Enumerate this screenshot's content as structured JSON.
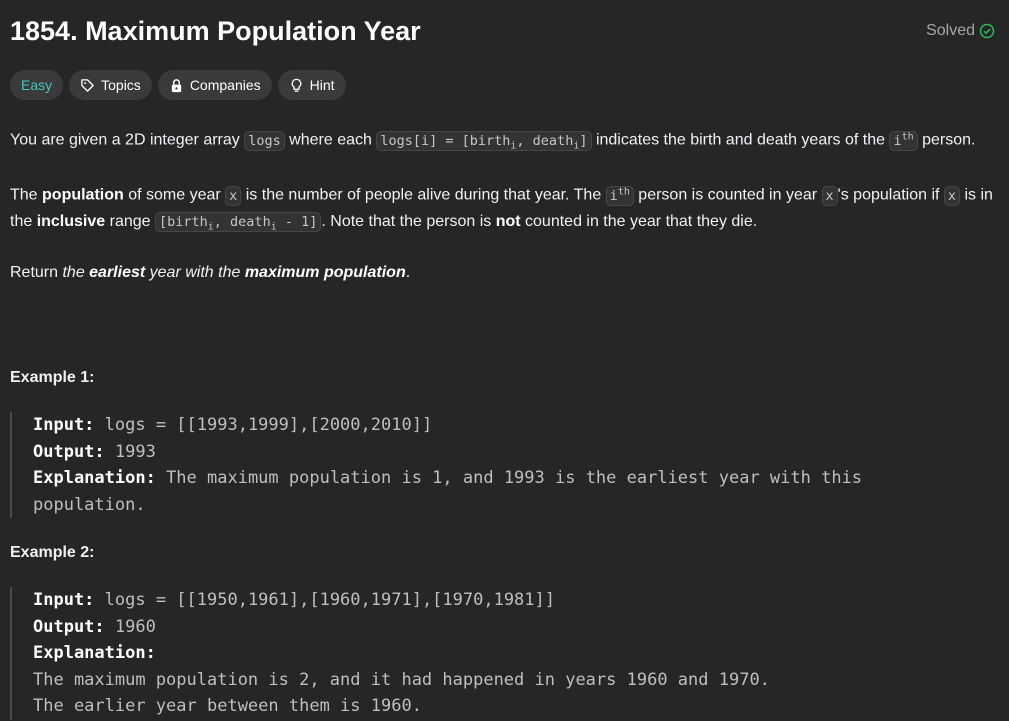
{
  "header": {
    "title": "1854. Maximum Population Year",
    "status": "Solved",
    "status_icon": "check-circle-icon",
    "status_color": "#2cbb5d"
  },
  "tags": {
    "difficulty": "Easy",
    "topics": "Topics",
    "companies": "Companies",
    "hint": "Hint"
  },
  "p1": {
    "t1": "You are given a 2D integer array ",
    "c1": "logs",
    "t2": " where each ",
    "c2a": "logs[i] = [birth",
    "c2sub1": "i",
    "c2b": ", death",
    "c2sub2": "i",
    "c2c": "]",
    "t3": " indicates the birth and death years of the ",
    "c3": "i",
    "c3sup": "th",
    "t4": " person."
  },
  "p2": {
    "t1": "The ",
    "b1": "population",
    "t2": " of some year ",
    "c1": "x",
    "t3": " is the number of people alive during that year. The ",
    "c2": "i",
    "c2sup": "th",
    "t4": " person is counted in year ",
    "c3": "x",
    "t5": "'s population if ",
    "c4": "x",
    "t6": " is in the ",
    "b2": "inclusive",
    "t7": " range ",
    "c5a": "[birth",
    "c5sub1": "i",
    "c5b": ", death",
    "c5sub2": "i",
    "c5c": " - 1]",
    "t8": ". Note that the person is ",
    "b3": "not",
    "t9": " counted in the year that they die."
  },
  "p3": {
    "t1": "Return ",
    "i1": "the ",
    "bi1": "earliest",
    "i2": " year with the ",
    "bi2": "maximum population",
    "t2": "."
  },
  "examples": [
    {
      "title": "Example 1:",
      "input_label": "Input:",
      "input": " logs = [[1993,1999],[2000,2010]]",
      "output_label": "Output:",
      "output": " 1993",
      "explanation_label": "Explanation:",
      "explanation": " The maximum population is 1, and 1993 is the earliest year with this population."
    },
    {
      "title": "Example 2:",
      "input_label": "Input:",
      "input": " logs = [[1950,1961],[1960,1971],[1970,1981]]",
      "output_label": "Output:",
      "output": " 1960",
      "explanation_label": "Explanation:",
      "explanation_l1": "The maximum population is 2, and it had happened in years 1960 and 1970.",
      "explanation_l2": "The earlier year between them is 1960."
    }
  ]
}
